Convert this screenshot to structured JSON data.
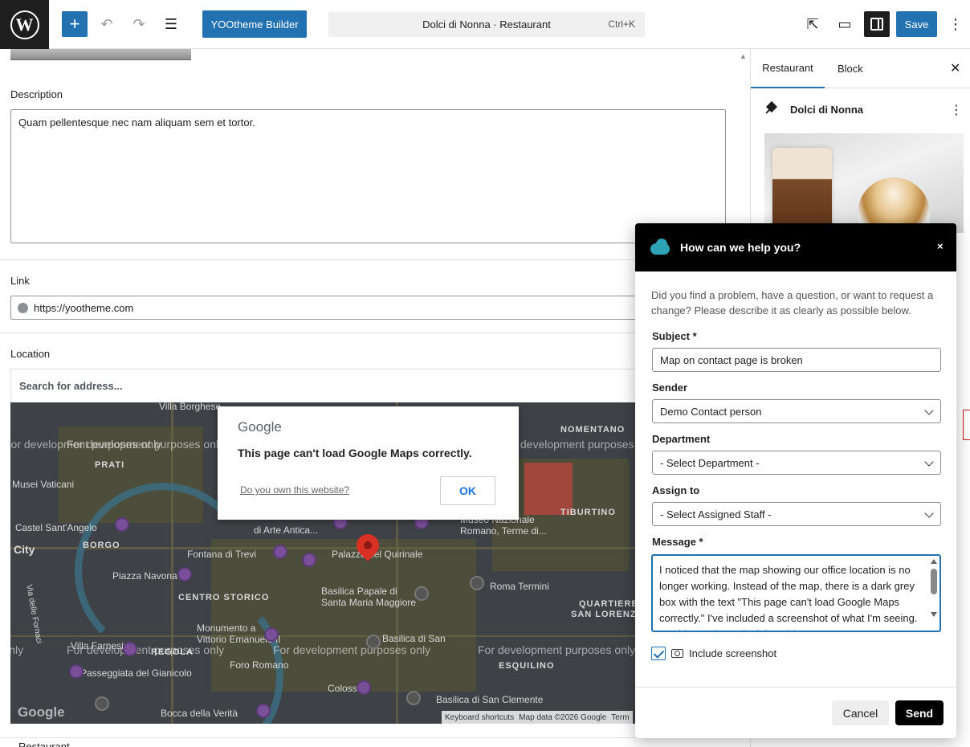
{
  "topbar": {
    "wp_logo": "W",
    "add_icon": "+",
    "undo_icon": "↶",
    "redo_icon": "↷",
    "list_view_icon": "☰",
    "builder_label": "YOOtheme Builder",
    "command_title": "Dolci di Nonna · Restaurant",
    "command_shortcut": "Ctrl+K",
    "external_icon": "⇱",
    "preview_icon": "▭",
    "save_label": "Save",
    "more_icon": "⋮"
  },
  "editor": {
    "description_label": "Description",
    "description_value": "Quam pellentesque nec nam aliquam sem et tortor.",
    "link_label": "Link",
    "link_value": "https://yootheme.com",
    "location_label": "Location",
    "search_placeholder": "Search for address...",
    "next_section_label": "Restaurant"
  },
  "map": {
    "error_brand": "Google",
    "error_message": "This page can't load Google Maps correctly.",
    "own_website_link": "Do you own this website?",
    "ok_label": "OK",
    "watermark": "For development purposes only",
    "logo": "Google",
    "attribution": [
      "Keyboard shortcuts",
      "Map data ©2026 Google",
      "Term"
    ],
    "labels": {
      "prati": "PRATI",
      "musei": "Musei Vaticani",
      "castel": "Castel Sant'Angelo",
      "borgo": "BORGO",
      "city": "City",
      "piazza": "Piazza Navona",
      "centro": "CENTRO STORICO",
      "fontana": "Fontana di Trevi",
      "quirinale": "Palazzo del Quirinale",
      "arte": "di Arte Antica...",
      "nomentano": "NOMENTANO",
      "tiburtino": "TIBURTINO",
      "nazionale": "Museo Nazionale",
      "romano": "Romano, Terme di...",
      "basilica_maggiore": "Basilica Papale di",
      "santa_maria": "Santa Maria Maggiore",
      "roma_termini": "Roma Termini",
      "quartiere": "QUARTIERE",
      "san_lorenzo": "SAN LORENZO",
      "monumento": "Monumento a",
      "vittorio": "Vittorio Emanuele II",
      "farnesina": "Villa Farnesina",
      "foro": "Foro Romano",
      "gianicolo": "Passeggiata del Gianicolo",
      "esquilino": "ESQUILINO",
      "colosseo": "Colosseo",
      "basilica_san": "Basilica di San",
      "basilica_clemente": "Basilica di San Clemente",
      "bocca": "Bocca della Verità",
      "fornaci": "Via delle Fornaci",
      "villa_borghese": "Villa Borghese",
      "regola": "REGOLA"
    }
  },
  "sidebar": {
    "tab_restaurant": "Restaurant",
    "tab_block": "Block",
    "close_icon": "✕",
    "block_title": "Dolci di Nonna",
    "more_icon": "⋮"
  },
  "help_modal": {
    "title": "How can we help you?",
    "close_icon": "×",
    "intro": "Did you find a problem, have a question, or want to request a change? Please describe it as clearly as possible below.",
    "subject_label": "Subject *",
    "subject_value": "Map on contact page is broken",
    "sender_label": "Sender",
    "sender_value": "Demo Contact person",
    "department_label": "Department",
    "department_value": "- Select Department -",
    "assign_label": "Assign to",
    "assign_value": "- Select Assigned Staff -",
    "message_label": "Message *",
    "message_value": "I noticed that the map showing our office location is no longer working. Instead of the map, there is a dark grey box with the text \"This page can't load Google Maps correctly.\" I've included a screenshot of what I'm seeing. Could you please look into this",
    "include_screenshot_label": "Include screenshot",
    "include_screenshot_checked": true,
    "cancel_label": "Cancel",
    "send_label": "Send"
  },
  "colors": {
    "wp_blue": "#2271b1",
    "topbar_dark": "#1e1e1e",
    "modal_header": "#000000",
    "cloud_teal": "#2ea3b5",
    "map_bg": "#3e4146",
    "pin_red": "#d93025"
  }
}
